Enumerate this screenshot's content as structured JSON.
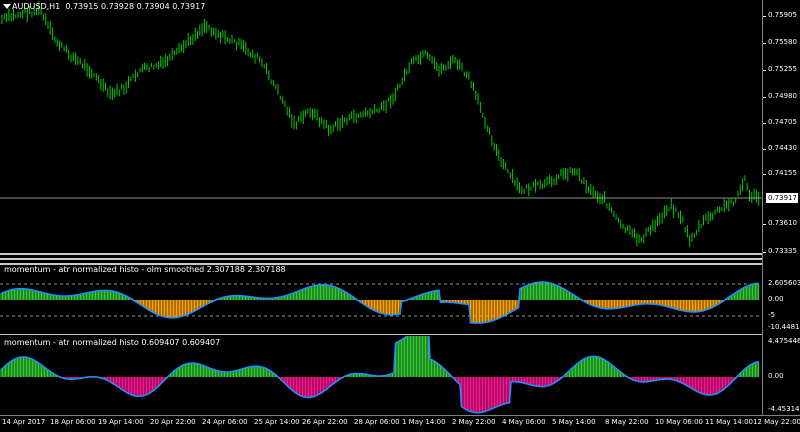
{
  "main_chart": {
    "title": "AUDUSD,H1",
    "ohlc": "0.73915 0.73928 0.73904 0.73917",
    "current_price": "0.73917",
    "price_labels": [
      "0.75905",
      "0.75580",
      "0.75255",
      "0.74980",
      "0.74705",
      "0.74430",
      "0.74155",
      "0.73610",
      "0.73335"
    ],
    "colors": {
      "bars": "#00cc00",
      "background": "#000000",
      "price_line": "#c0c0c0"
    }
  },
  "indicator1": {
    "title": "momentum - atr normalized histo - olm smoothed 2.307188 2.307188",
    "labels": [
      "2.605603",
      "0.00",
      "-5",
      "-10.448145"
    ],
    "colors": {
      "positive": "#33cc33",
      "negative": "#ffa500",
      "line": "#1e90ff"
    }
  },
  "indicator2": {
    "title": "momentum - atr normalized histo 0.609407 0.609407",
    "labels": [
      "4.475446",
      "0.00",
      "-4.453141"
    ],
    "colors": {
      "positive": "#33cc33",
      "negative": "#ff1493",
      "line": "#1e90ff"
    }
  },
  "time_axis": [
    "14 Apr 2017",
    "18 Apr 06:00",
    "19 Apr 14:00",
    "20 Apr 22:00",
    "24 Apr 06:00",
    "25 Apr 14:00",
    "26 Apr 22:00",
    "28 Apr 06:00",
    "1 May 14:00",
    "2 May 22:00",
    "4 May 06:00",
    "5 May 14:00",
    "8 May 22:00",
    "10 May 06:00",
    "11 May 14:00",
    "12 May 22:00"
  ]
}
